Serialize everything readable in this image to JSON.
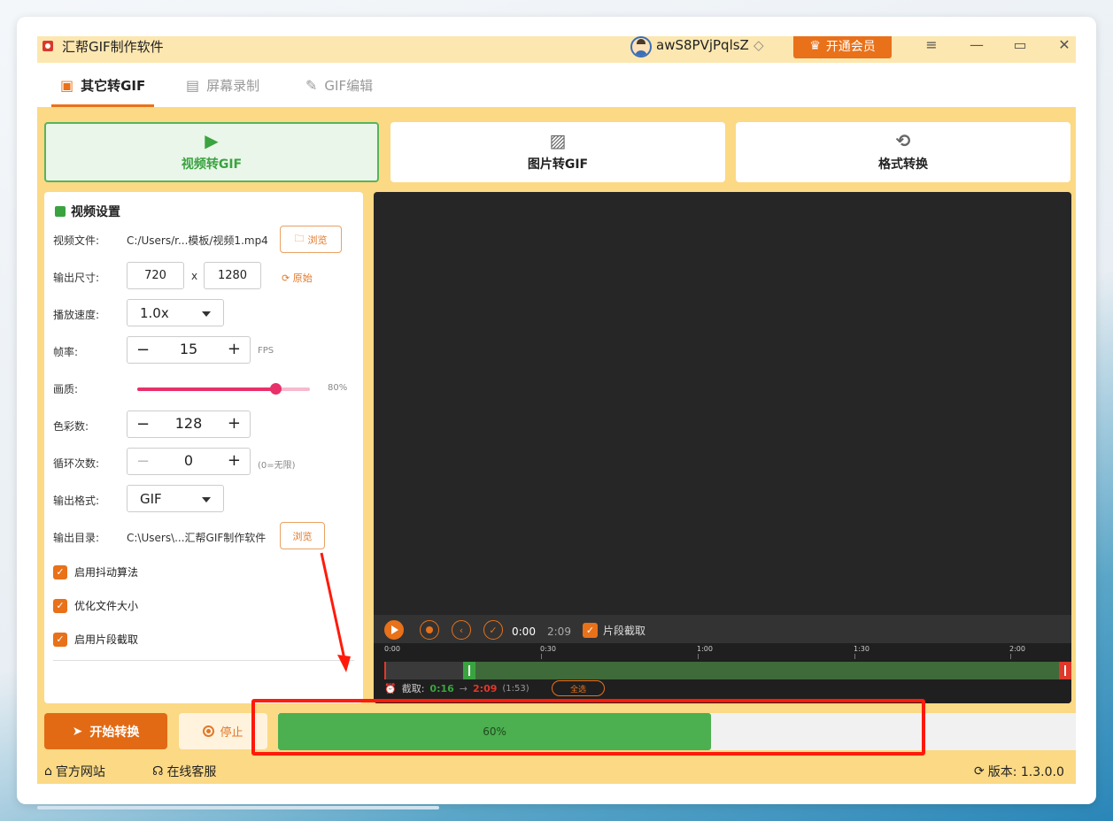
{
  "window": {
    "title": "汇帮GIF制作软件",
    "username": "awS8PVjPqlsZ",
    "vip_button": "开通会员",
    "menu_icon": "≡",
    "minimize_icon": "—",
    "maximize_icon": "▭",
    "close_icon": "✕"
  },
  "tabs": [
    {
      "label": "其它转GIF",
      "icon": "image-icon",
      "active": true
    },
    {
      "label": "屏幕录制",
      "icon": "camera-icon",
      "active": false
    },
    {
      "label": "GIF编辑",
      "icon": "edit-icon",
      "active": false
    }
  ],
  "modes": [
    {
      "label": "视频转GIF",
      "icon": "video-icon",
      "active": true
    },
    {
      "label": "图片转GIF",
      "icon": "picture-icon",
      "active": false
    },
    {
      "label": "格式转换",
      "icon": "convert-icon",
      "active": false
    }
  ],
  "settings": {
    "header": "视频设置",
    "video_file_label": "视频文件:",
    "video_file_path": "C:/Users/r...模板/视频1.mp4",
    "browse_label": "浏览",
    "output_size_label": "输出尺寸:",
    "width": "720",
    "size_sep": "x",
    "height": "1280",
    "reset_label": "原始",
    "speed_label": "播放速度:",
    "speed_value": "1.0x",
    "fps_label": "帧率:",
    "fps_value": "15",
    "fps_unit": "FPS",
    "quality_label": "画质:",
    "quality_percent": 80,
    "quality_text": "80%",
    "colors_label": "色彩数:",
    "colors_value": "128",
    "loop_label": "循环次数:",
    "loop_value": "0",
    "loop_hint": "(0=无限)",
    "format_label": "输出格式:",
    "format_value": "GIF",
    "output_dir_label": "输出目录:",
    "output_dir_path": "C:\\Users\\...汇帮GIF制作软件",
    "output_browse_label": "浏览",
    "options": [
      {
        "label": "启用抖动算法",
        "checked": true
      },
      {
        "label": "优化文件大小",
        "checked": true
      },
      {
        "label": "启用片段截取",
        "checked": true
      }
    ],
    "minus": "−",
    "plus": "+"
  },
  "player": {
    "current_time": "0:00",
    "total_time": "2:09",
    "segment_label": "片段截取",
    "ticks": [
      "0:00",
      "0:30",
      "1:00",
      "1:30",
      "2:00"
    ],
    "clip_label": "截取:",
    "clip_start": "0:16",
    "clip_arrow": "→",
    "clip_end": "2:09",
    "clip_duration": "(1:53)",
    "select_all": "全选",
    "duration_seconds": 129,
    "clip_start_seconds": 16,
    "clip_end_seconds": 129
  },
  "actions": {
    "start_label": "开始转换",
    "stop_label": "停止",
    "progress_percent": 60,
    "progress_text": "60%"
  },
  "footer": {
    "website": "官方网站",
    "support": "在线客服",
    "version": "版本: 1.3.0.0"
  },
  "colors": {
    "accent": "#e8711a",
    "green": "#3aa340",
    "highlight_red": "#ff1a0a"
  }
}
